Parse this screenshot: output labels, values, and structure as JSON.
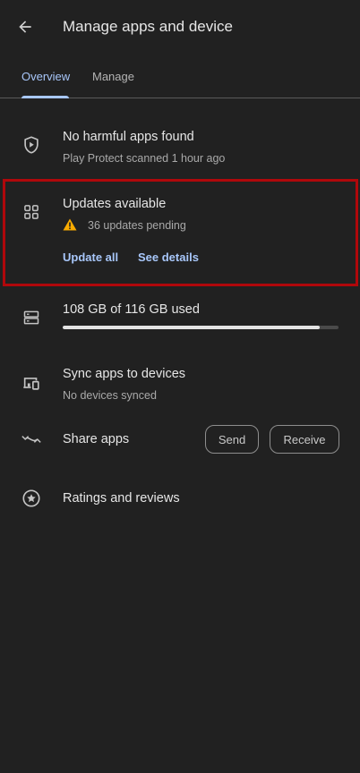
{
  "header": {
    "title": "Manage apps and device"
  },
  "tabs": [
    {
      "label": "Overview",
      "active": true
    },
    {
      "label": "Manage",
      "active": false
    }
  ],
  "protect": {
    "title": "No harmful apps found",
    "subtitle": "Play Protect scanned 1 hour ago",
    "icon": "play-protect-shield-icon"
  },
  "updates": {
    "title": "Updates available",
    "subtitle": "36 updates pending",
    "update_all_label": "Update all",
    "see_details_label": "See details",
    "icon": "apps-grid-icon",
    "warning_color": "#f9ab00"
  },
  "storage": {
    "title": "108 GB of 116 GB used",
    "used_gb": 108,
    "total_gb": 116,
    "icon": "storage-icon"
  },
  "sync": {
    "title": "Sync apps to devices",
    "subtitle": "No devices synced",
    "icon": "devices-icon"
  },
  "share": {
    "title": "Share apps",
    "send_label": "Send",
    "receive_label": "Receive",
    "icon": "share-arrows-icon"
  },
  "ratings": {
    "title": "Ratings and reviews",
    "icon": "star-circle-icon"
  },
  "colors": {
    "accent": "#a8c7fa",
    "background": "#212121",
    "highlight_border": "#b0080b"
  }
}
